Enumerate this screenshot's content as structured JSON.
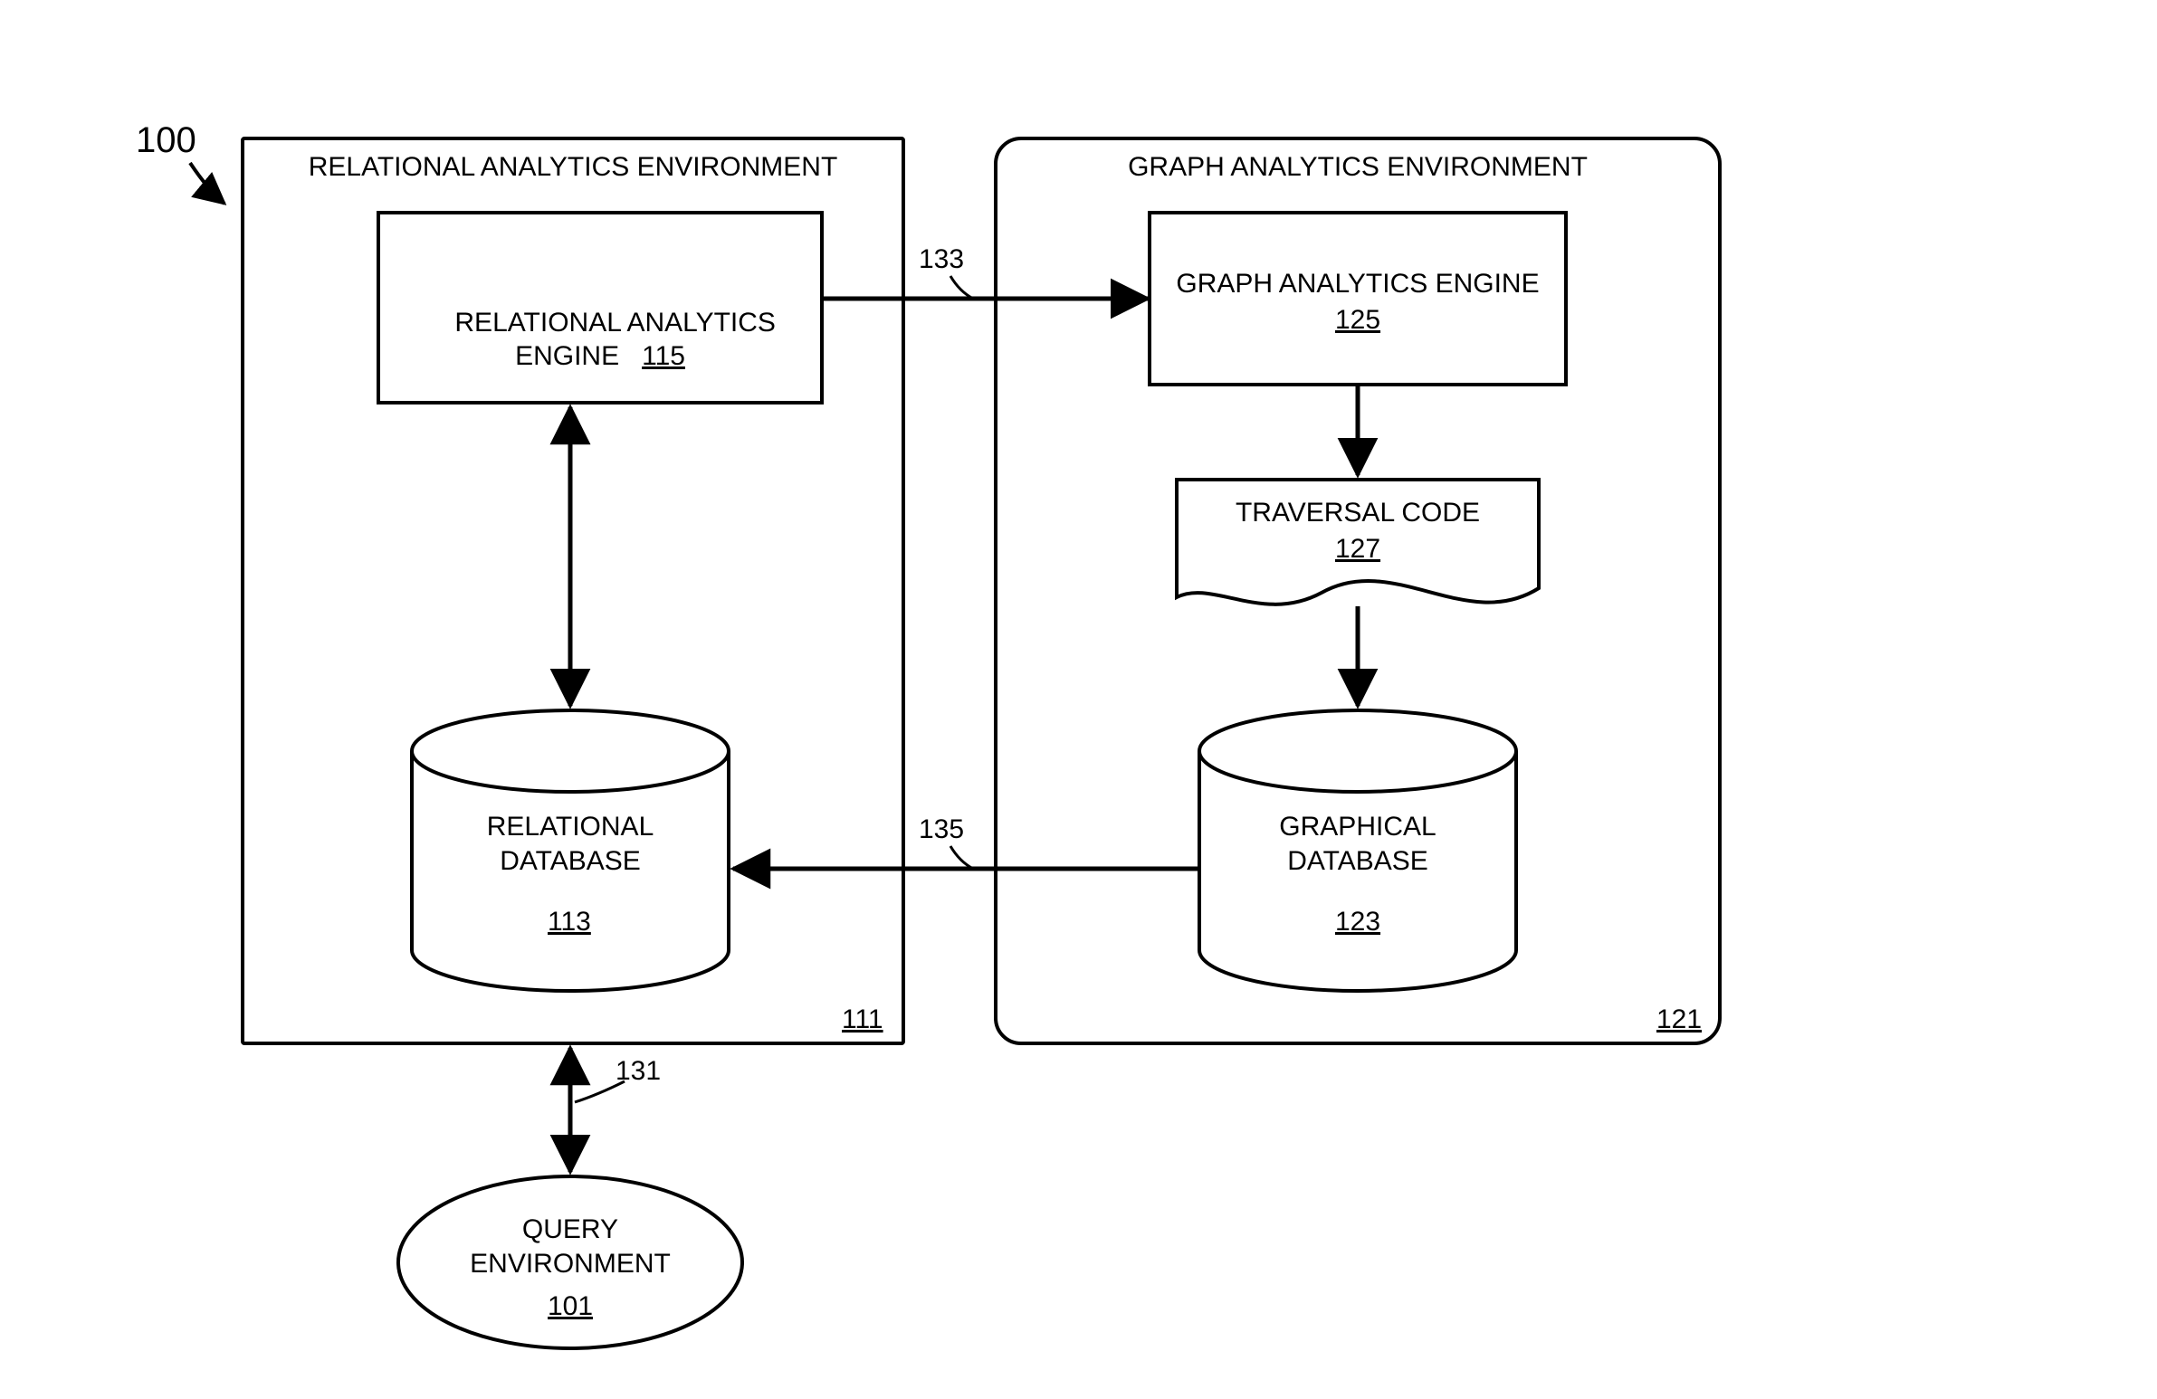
{
  "figure_ref": "100",
  "relational_env": {
    "title": "RELATIONAL ANALYTICS ENVIRONMENT",
    "ref": "111",
    "engine": {
      "label": "RELATIONAL ANALYTICS\nENGINE",
      "ref": "115"
    },
    "database": {
      "label": "RELATIONAL\nDATABASE",
      "ref": "113"
    }
  },
  "graph_env": {
    "title": "GRAPH ANALYTICS ENVIRONMENT",
    "ref": "121",
    "engine": {
      "label": "GRAPH ANALYTICS ENGINE",
      "ref": "125"
    },
    "traversal": {
      "label": "TRAVERSAL CODE",
      "ref": "127"
    },
    "database": {
      "label": "GRAPHICAL\nDATABASE",
      "ref": "123"
    }
  },
  "connectors": {
    "c131": "131",
    "c133": "133",
    "c135": "135"
  },
  "query_env": {
    "label": "QUERY\nENVIRONMENT",
    "ref": "101"
  }
}
